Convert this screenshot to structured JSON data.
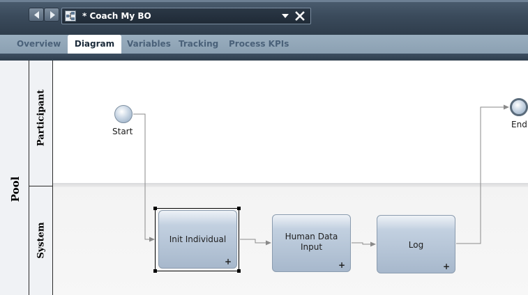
{
  "window": {
    "tab_title": "* Coach My BO",
    "icons": {
      "back": "left-arrow-icon",
      "forward": "right-arrow-icon",
      "process": "process-diagram-icon",
      "dropdown": "dropdown-arrow-icon",
      "close": "close-icon"
    }
  },
  "editor_tabs": [
    {
      "label": "Overview",
      "active": false
    },
    {
      "label": "Diagram",
      "active": true
    },
    {
      "label": "Variables",
      "active": false
    },
    {
      "label": "Tracking",
      "active": false
    },
    {
      "label": "Process KPIs",
      "active": false
    }
  ],
  "diagram": {
    "pool": {
      "label": "Pool"
    },
    "lanes": [
      {
        "label": "Participant"
      },
      {
        "label": "System"
      }
    ],
    "events": {
      "start": {
        "label": "Start"
      },
      "end": {
        "label": "End"
      }
    },
    "activities": [
      {
        "label": "Init Individual",
        "selected": true,
        "expand": "+"
      },
      {
        "label": "Human Data Input",
        "label_lines": [
          "Human Data",
          "Input"
        ],
        "selected": false,
        "expand": "+"
      },
      {
        "label": "Log",
        "selected": false,
        "expand": "+"
      }
    ]
  },
  "colors": {
    "titlebar": "#3b4b5c",
    "tabbar": "#8ba0b2",
    "active_tab_text": "#1c2b3a",
    "activity_fill": "#a7b8cc"
  }
}
